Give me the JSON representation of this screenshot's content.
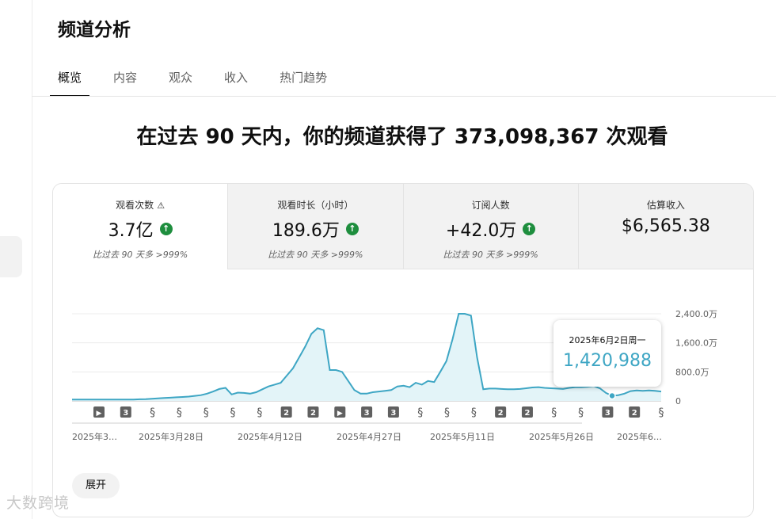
{
  "header": {
    "title": "频道分析"
  },
  "tabs": [
    {
      "label": "概览",
      "active": true
    },
    {
      "label": "内容"
    },
    {
      "label": "观众"
    },
    {
      "label": "收入"
    },
    {
      "label": "热门趋势"
    }
  ],
  "headline": "在过去 90 天内，你的频道获得了 373,098,367 次观看",
  "metrics": [
    {
      "label": "观看次数",
      "value": "3.7亿",
      "sub": "比过去 90 天多 >999%",
      "up": true,
      "warning_icon": "warning-icon"
    },
    {
      "label": "观看时长（小时）",
      "value": "189.6万",
      "sub": "比过去 90 天多 >999%",
      "up": true
    },
    {
      "label": "订阅人数",
      "value": "+42.0万",
      "sub": "比过去 90 天多 >999%",
      "up": true
    },
    {
      "label": "估算收入",
      "value": "$6,565.38",
      "sub": "",
      "up": false
    }
  ],
  "tooltip": {
    "date": "2025年6月2日周一",
    "value": "1,420,988"
  },
  "expand_label": "展开",
  "watermark": "大数跨境",
  "colors": {
    "line": "#3ea6c4",
    "fill": "#e3f4f8",
    "up_badge": "#1e8e3e"
  },
  "chart_data": {
    "type": "area",
    "x_ticks": [
      "2025年3…",
      "2025年3月28日",
      "2025年4月12日",
      "2025年4月27日",
      "2025年5月11日",
      "2025年5月26日",
      "2025年6…"
    ],
    "y_ticks": [
      "2,400.0万",
      "1,600.0万",
      "800.0万",
      "0"
    ],
    "ylim": [
      0,
      24000000
    ],
    "values": [
      400000,
      400000,
      400000,
      400000,
      400000,
      400000,
      400000,
      400000,
      400000,
      400000,
      400000,
      450000,
      500000,
      600000,
      700000,
      800000,
      900000,
      1000000,
      1100000,
      1200000,
      1400000,
      1600000,
      2000000,
      2600000,
      3300000,
      3600000,
      1800000,
      2300000,
      2200000,
      2000000,
      2400000,
      3200000,
      4000000,
      4500000,
      5000000,
      7000000,
      9000000,
      12000000,
      15000000,
      18500000,
      20000000,
      19500000,
      8500000,
      8500000,
      8000000,
      5500000,
      3000000,
      2000000,
      2000000,
      2400000,
      2600000,
      2800000,
      3000000,
      4000000,
      4200000,
      3800000,
      5000000,
      4500000,
      5500000,
      5200000,
      8000000,
      11000000,
      17000000,
      24000000,
      24000000,
      23500000,
      12000000,
      3200000,
      3400000,
      3400000,
      3300000,
      3200000,
      3200000,
      3300000,
      3500000,
      3700000,
      3800000,
      3600000,
      3500000,
      3400000,
      3300000,
      3600000,
      3800000,
      3800000,
      3900000,
      4100000,
      3500000,
      2200000,
      1420988,
      1600000,
      2000000,
      2700000,
      2900000,
      2800000,
      2900000,
      2800000,
      2600000
    ],
    "highlight_index": 88,
    "annotations": [
      "video",
      "3",
      "shorts",
      "shorts",
      "shorts",
      "shorts",
      "shorts",
      "2",
      "2",
      "video",
      "3",
      "3",
      "shorts",
      "shorts",
      "shorts",
      "2",
      "2",
      "shorts",
      "shorts",
      "3",
      "2",
      "shorts"
    ],
    "grid": true
  }
}
